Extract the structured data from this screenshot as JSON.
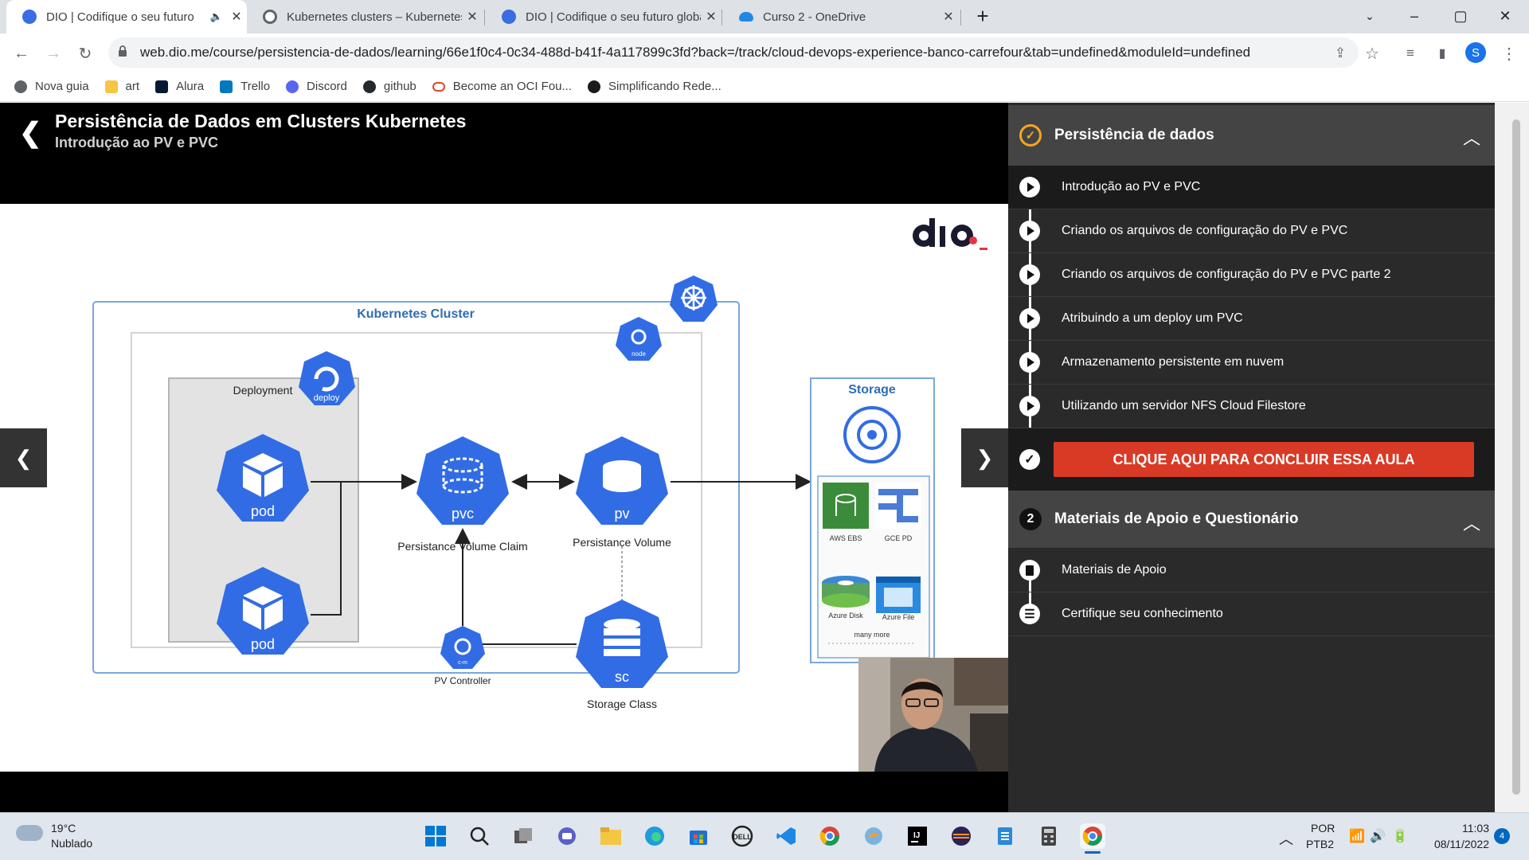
{
  "browser": {
    "tabs": [
      {
        "title": "DIO | Codifique o seu futuro",
        "active": true
      },
      {
        "title": "Kubernetes clusters – Kubernetes",
        "active": false
      },
      {
        "title": "DIO | Codifique o seu futuro global",
        "active": false
      },
      {
        "title": "Curso 2 - OneDrive",
        "active": false
      }
    ],
    "url": "web.dio.me/course/persistencia-de-dados/learning/66e1f0c4-0c34-488d-b41f-4a117899c3fd?back=/track/cloud-devops-experience-banco-carrefour&tab=undefined&moduleId=undefined",
    "profile_initial": "S",
    "bookmarks": [
      "Nova guia",
      "art",
      "Alura",
      "Trello",
      "Discord",
      "github",
      "Become an OCI Fou...",
      "Simplificando Rede..."
    ]
  },
  "header": {
    "course_title": "Persistência de Dados em Clusters Kubernetes",
    "lesson_subtitle": "Introdução ao PV e PVC"
  },
  "slide": {
    "cluster_title": "Kubernetes Cluster",
    "deployment": "Deployment",
    "deploy_badge": "deploy",
    "node_badge": "node",
    "pod1": "pod",
    "pod2": "pod",
    "pvc": "pvc",
    "pvc_caption": "Persistance Volume Claim",
    "pv": "pv",
    "pv_caption": "Persistance Volume",
    "sc": "sc",
    "sc_caption": "Storage Class",
    "cm_badge": "c-m",
    "controller_caption": "PV Controller",
    "storage_title": "Storage",
    "providers": [
      "AWS EBS",
      "GCE PD",
      "Azure Disk",
      "Azure File"
    ],
    "many_more": "many more",
    "brand": "dio"
  },
  "sidebar": {
    "module1": {
      "title": "Persistência de dados",
      "lessons": [
        "Introdução ao PV e PVC",
        "Criando os arquivos de configuração do PV e PVC",
        "Criando os arquivos de configuração do PV e PVC parte 2",
        "Atribuindo a um deploy um PVC",
        "Armazenamento persistente em nuvem",
        "Utilizando um servidor NFS Cloud Filestore"
      ],
      "conclude_label": "CLIQUE AQUI PARA CONCLUIR ESSA AULA"
    },
    "module2": {
      "number": "2",
      "title": "Materiais de Apoio e Questionário",
      "items": [
        "Materiais de Apoio",
        "Certifique seu conhecimento"
      ]
    }
  },
  "taskbar": {
    "temperature": "19°C",
    "weather": "Nublado",
    "lang": "POR",
    "layout": "PTB2",
    "time": "11:03",
    "date": "08/11/2022",
    "notifications": "4"
  },
  "colors": {
    "accent_orange": "#f5a623",
    "conclude_red": "#d93a26",
    "k8s_blue": "#326ce5"
  }
}
